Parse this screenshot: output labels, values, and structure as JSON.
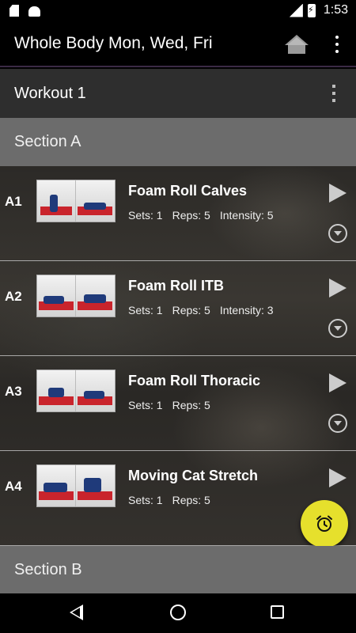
{
  "status_bar": {
    "time": "1:53",
    "network": "LTE"
  },
  "app_bar": {
    "title": "Whole Body Mon, Wed, Fri"
  },
  "workout": {
    "title": "Workout 1"
  },
  "sections": [
    {
      "label": "Section A"
    },
    {
      "label": "Section B"
    }
  ],
  "exercises": [
    {
      "code": "A1",
      "name": "Foam Roll Calves",
      "sets": "Sets: 1",
      "reps": "Reps: 5",
      "intensity": "Intensity: 5"
    },
    {
      "code": "A2",
      "name": "Foam Roll ITB",
      "sets": "Sets: 1",
      "reps": "Reps: 5",
      "intensity": "Intensity: 3"
    },
    {
      "code": "A3",
      "name": "Foam Roll Thoracic",
      "sets": "Sets: 1",
      "reps": "Reps: 5",
      "intensity": ""
    },
    {
      "code": "A4",
      "name": "Moving Cat Stretch",
      "sets": "Sets: 1",
      "reps": "Reps: 5",
      "intensity": ""
    }
  ],
  "icons": {
    "home": "home-icon",
    "overflow": "overflow-menu-icon",
    "play": "play-icon",
    "expand": "expand-icon",
    "alarm": "alarm-clock-icon"
  },
  "colors": {
    "fab": "#e6e02c",
    "section_header": "#6c6c6c",
    "workout_header": "#2e2e2e"
  }
}
